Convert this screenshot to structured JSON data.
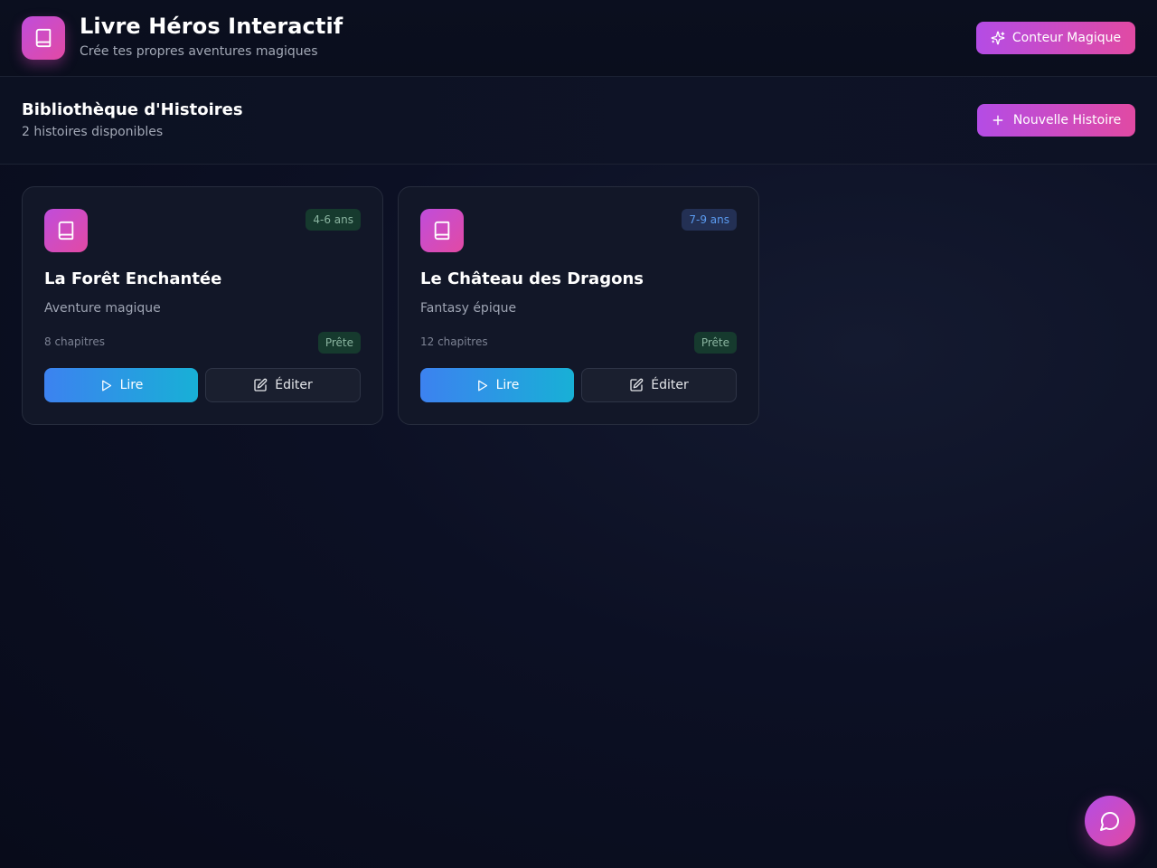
{
  "header": {
    "title": "Livre Héros Interactif",
    "subtitle": "Crée tes propres aventures magiques",
    "logo_icon": "book-icon",
    "storyteller_button": {
      "label": "Conteur Magique",
      "icon": "sparkles-icon"
    }
  },
  "library": {
    "title": "Bibliothèque d'Histoires",
    "count_text": "2 histoires disponibles",
    "new_story_button": {
      "label": "Nouvelle Histoire",
      "icon": "plus-icon"
    }
  },
  "stories": [
    {
      "title": "La Forêt Enchantée",
      "genre": "Aventure magique",
      "age": "4-6 ans",
      "age_color": "green",
      "chapters": "8 chapitres",
      "status": "Prête",
      "read_label": "Lire",
      "edit_label": "Éditer"
    },
    {
      "title": "Le Château des Dragons",
      "genre": "Fantasy épique",
      "age": "7-9 ans",
      "age_color": "blue",
      "chapters": "12 chapitres",
      "status": "Prête",
      "read_label": "Lire",
      "edit_label": "Éditer"
    }
  ],
  "chat_button": {
    "icon": "chat-bubble-icon"
  },
  "colors": {
    "background": "#0a0e1f",
    "accent_gradient_start": "#b44ce5",
    "accent_gradient_end": "#e14aa3",
    "read_gradient_start": "#3c82f0",
    "read_gradient_end": "#18b0d6",
    "status_green": "#163a2e",
    "age_blue": "#233054"
  }
}
